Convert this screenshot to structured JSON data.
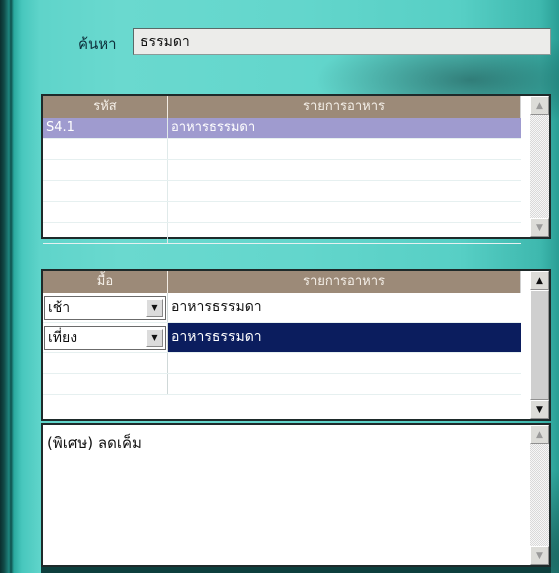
{
  "search": {
    "label": "ค้นหา",
    "value": "ธรรมดา"
  },
  "grid1": {
    "headers": [
      "รหัส",
      "รายการอาหาร"
    ],
    "rows": [
      {
        "code": "S4.1",
        "name": "อาหารธรรมดา",
        "selected": true
      }
    ]
  },
  "grid2": {
    "headers": [
      "มื้อ",
      "รายการอาหาร"
    ],
    "rows": [
      {
        "meal": "เช้า",
        "name": "อาหารธรรมดา"
      },
      {
        "meal": "เที่ยง",
        "name": "อาหารธรรมดา",
        "highlighted": true
      }
    ]
  },
  "note": {
    "text": "(พิเศษ) ลดเค็ม"
  },
  "colors": {
    "header_bg": "#9c8a78",
    "selected_row": "#9f9bcf",
    "highlight_row": "#0b1d5e",
    "background": "#63d6cc"
  },
  "icons": {
    "scroll_up": "triangle-up",
    "scroll_down": "triangle-down",
    "combo_arrow": "triangle-down"
  }
}
